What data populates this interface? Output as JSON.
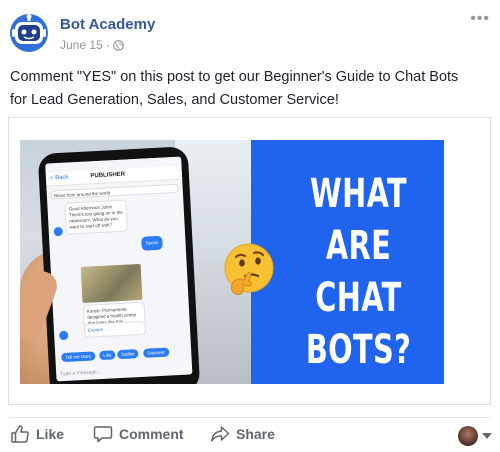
{
  "post": {
    "page_name": "Bot Academy",
    "date": "June 15",
    "separator": "·",
    "body": "Comment \"YES\" on this post to get our Beginner's Guide to Chat Bots for Lead Generation, Sales, and Customer Service!"
  },
  "image": {
    "title_lines": [
      "WHAT ARE",
      "CHAT",
      "BOTS?"
    ],
    "panel_color": "#1f63ef",
    "phone_screen": {
      "back_label": "< Back",
      "app_title": "PUBLISHER",
      "news_label": "News from around the world",
      "bubble_1": "Good Afternoon John! There's lots going on in the newsroom. What do you want to start off with?",
      "reply": "Sports",
      "bubble_2": "Kanye: Permanente designed a health center that looks like this",
      "link_label": "Explore",
      "chips": [
        "Tell me More",
        "Like",
        "Dislike",
        "Discover"
      ],
      "compose_placeholder": "Type a message..."
    }
  },
  "actions": {
    "like": "Like",
    "comment": "Comment",
    "share": "Share"
  },
  "icons": {
    "avatar": "robot-avatar-icon",
    "privacy": "globe-icon",
    "more": "more-options-icon",
    "like": "thumbs-up-icon",
    "comment": "comment-icon",
    "share": "share-arrow-icon",
    "emoji": "thinking-face-icon"
  },
  "colors": {
    "link_blue": "#365899",
    "meta_gray": "#90949c",
    "action_gray": "#606770",
    "brand_blue": "#1f63ef"
  }
}
